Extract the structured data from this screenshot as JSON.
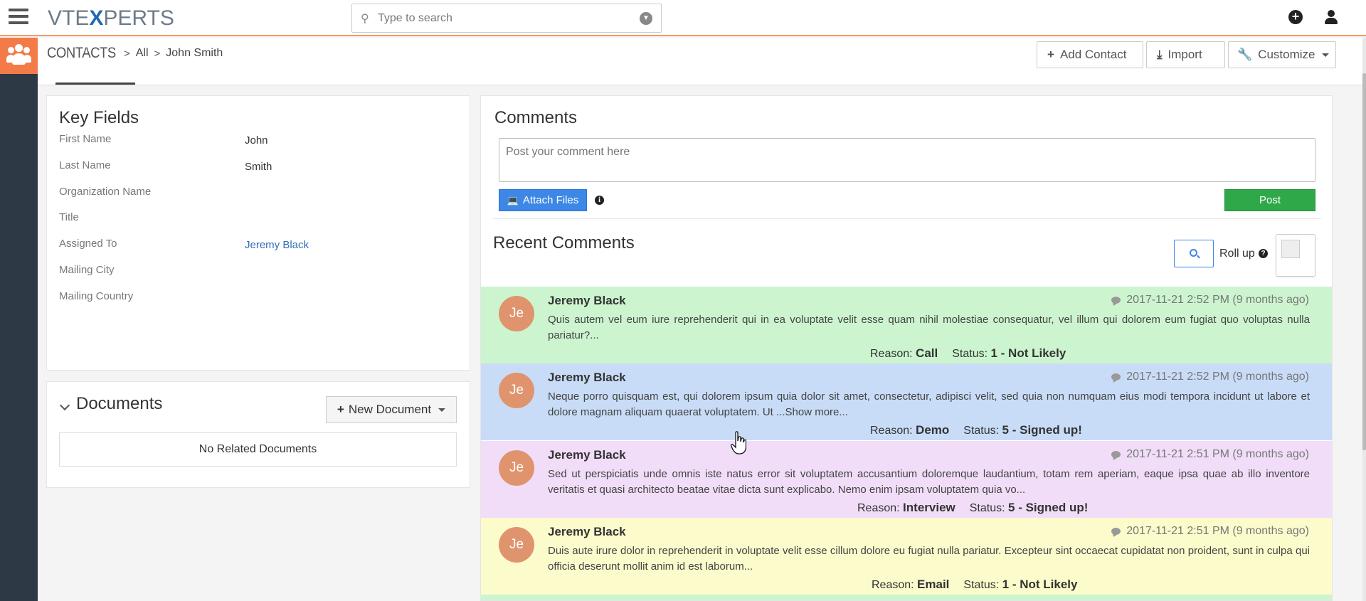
{
  "app": {
    "logo_prefix": "VTE",
    "logo_x": "X",
    "logo_suffix": "PERTS"
  },
  "search": {
    "placeholder": "Type to search"
  },
  "breadcrumb": {
    "module": "CONTACTS",
    "filter": "All",
    "record": "John Smith"
  },
  "header_actions": {
    "add_contact": "Add Contact",
    "import": "Import",
    "customize": "Customize"
  },
  "key_fields": {
    "title": "Key Fields",
    "fields": [
      {
        "label": "First Name",
        "value": "John"
      },
      {
        "label": "Last Name",
        "value": "Smith"
      },
      {
        "label": "Organization Name",
        "value": ""
      },
      {
        "label": "Title",
        "value": ""
      },
      {
        "label": "Assigned To",
        "value": "Jeremy Black"
      },
      {
        "label": "Mailing City",
        "value": ""
      },
      {
        "label": "Mailing Country",
        "value": ""
      }
    ]
  },
  "documents": {
    "title": "Documents",
    "new_button": "New Document",
    "empty_text": "No Related Documents"
  },
  "comments": {
    "title": "Comments",
    "placeholder": "Post your comment here",
    "attach_label": "Attach Files",
    "post_label": "Post",
    "recent_title": "Recent Comments",
    "rollup_label": "Roll up",
    "items": [
      {
        "initials": "Je",
        "author": "Jeremy Black",
        "timestamp": "2017-11-21 2:52 PM (9 months ago)",
        "text": "Quis autem vel eum iure reprehenderit qui in ea voluptate velit esse quam nihil molestiae consequatur, vel illum qui dolorem eum fugiat quo voluptas nulla pariatur?...",
        "reason_label": "Reason:",
        "reason": "Call",
        "status_label": "Status:",
        "status": "1 - Not Likely",
        "bg": "#ccf5cf"
      },
      {
        "initials": "Je",
        "author": "Jeremy Black",
        "timestamp": "2017-11-21 2:52 PM (9 months ago)",
        "text": "Neque porro quisquam est, qui dolorem ipsum quia dolor sit amet, consectetur, adipisci velit, sed quia non numquam eius modi tempora incidunt ut labore et dolore magnam aliquam quaerat voluptatem. Ut ...Show more...",
        "reason_label": "Reason:",
        "reason": "Demo",
        "status_label": "Status:",
        "status": "5 - Signed up!",
        "bg": "#c8dcf7"
      },
      {
        "initials": "Je",
        "author": "Jeremy Black",
        "timestamp": "2017-11-21 2:51 PM (9 months ago)",
        "text": "Sed ut perspiciatis unde omnis iste natus error sit voluptatem accusantium doloremque laudantium, totam rem aperiam, eaque ipsa quae ab illo inventore veritatis et quasi architecto beatae vitae dicta sunt explicabo. Nemo enim ipsam voluptatem quia vo...",
        "reason_label": "Reason:",
        "reason": "Interview",
        "status_label": "Status:",
        "status": "5 - Signed up!",
        "bg": "#f1ddf8"
      },
      {
        "initials": "Je",
        "author": "Jeremy Black",
        "timestamp": "2017-11-21 2:51 PM (9 months ago)",
        "text": "Duis aute irure dolor in reprehenderit in voluptate velit esse cillum dolore eu fugiat nulla pariatur. Excepteur sint occaecat cupidatat non proident, sunt in culpa qui officia deserunt mollit anim id est laborum...",
        "reason_label": "Reason:",
        "reason": "Email",
        "status_label": "Status:",
        "status": "1 - Not Likely",
        "bg": "#fcfbcc"
      }
    ]
  },
  "colors": {
    "accent": "#f37b48",
    "sidebar": "#2d3a45",
    "primary_button": "#3d88e6",
    "post_button": "#2fa84a",
    "link": "#2f6fb7"
  }
}
